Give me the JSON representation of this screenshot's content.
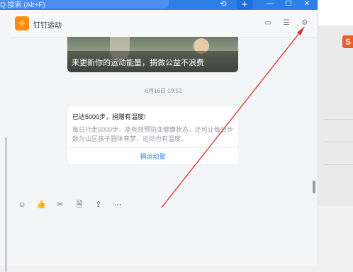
{
  "topbar": {
    "search_text": "Q 搜索 (Alt+F)",
    "add_label": "+"
  },
  "chat": {
    "title": "钉钉运动",
    "banner_text": "来更新你的运动能量，捐做公益不浪费",
    "timestamp": "6月16日 19:52",
    "card": {
      "title": "已达5000步，捐赠有温度!",
      "body": "每日行走5000步，能有效预防亚健康状态，还可让每日步数为山区孩子圆体育梦，运动也有温度。",
      "link": "捐运动量"
    }
  },
  "icons": {
    "header": [
      "folder-icon",
      "search-record-icon",
      "settings-gear-icon"
    ],
    "toolbar": [
      "emoji-icon",
      "like-icon",
      "scissors-icon",
      "document-add-icon",
      "folder-upload-icon",
      "more-icon"
    ]
  },
  "colors": {
    "accent": "#2f7fe8",
    "app_icon": "#ff8a1c",
    "annotation_arrow": "#d63131"
  }
}
